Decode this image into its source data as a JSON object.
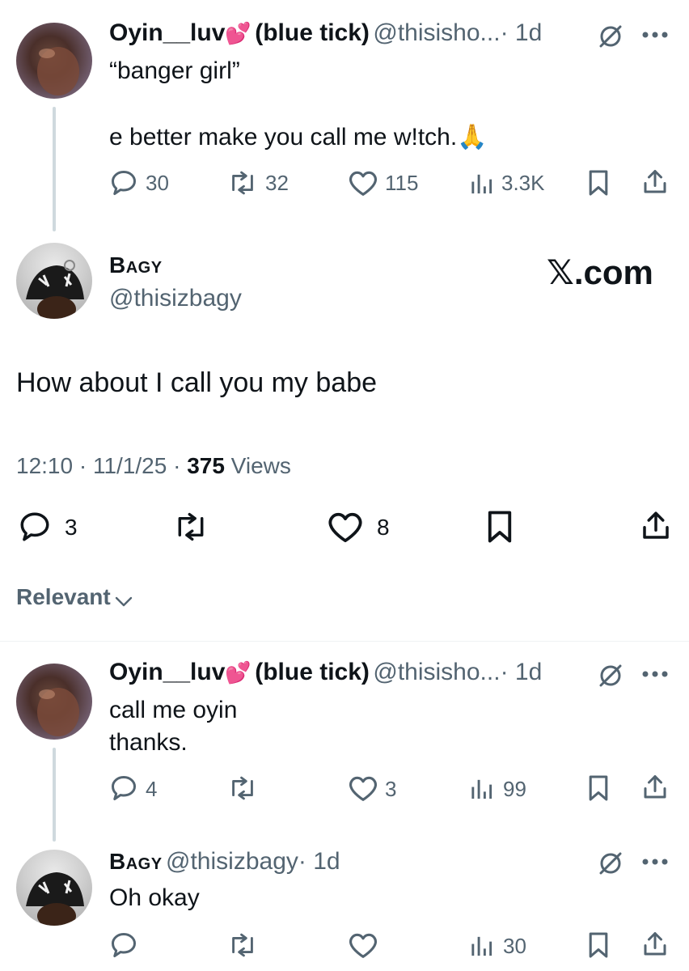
{
  "reply1": {
    "name": "Oyin__luv",
    "name_suffix": "(blue tick)",
    "handle": "@thisisho...",
    "time": "· 1d",
    "line1": "“banger girl”",
    "line2": "e better make you call me w!tch.",
    "emoji": "🙏",
    "reply_count": "30",
    "retweet_count": "32",
    "like_count": "115",
    "view_count": "3.3K"
  },
  "main": {
    "name": "Bagy",
    "handle": "@thisizbagy",
    "watermark": "𝕏.com",
    "text": "How about I call you my babe",
    "time": "12:10 · 11/1/25 · ",
    "views_count": "375",
    "views_label": " Views",
    "reply_count": "3",
    "like_count": "8"
  },
  "sort": {
    "label": "Relevant"
  },
  "reply2": {
    "name": "Oyin__luv",
    "name_suffix": "(blue tick)",
    "handle": "@thisisho...",
    "time": "· 1d",
    "line1": "call me oyin",
    "line2": "thanks.",
    "reply_count": "4",
    "like_count": "3",
    "view_count": "99"
  },
  "reply3": {
    "name": "Bagy",
    "handle": "@thisizbagy",
    "time": "· 1d",
    "text": "Oh okay",
    "view_count": "30"
  },
  "icons": {
    "heart_emoji": "💕",
    "grok": "grok-icon",
    "more": "more-dots-icon"
  }
}
